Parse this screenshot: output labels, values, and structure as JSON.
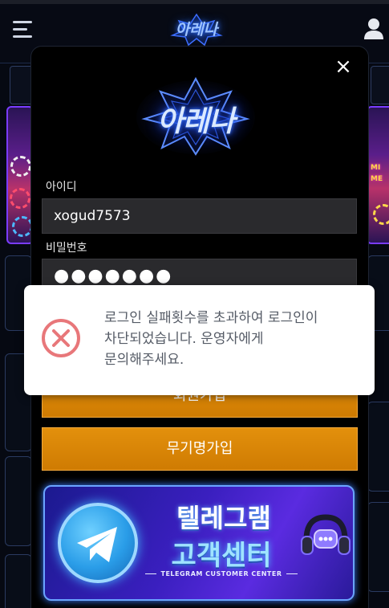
{
  "header": {
    "logo_text": "아레나"
  },
  "login": {
    "logo_text": "아레나",
    "close_glyph": "×",
    "id_label": "아이디",
    "id_value": "xogud7573",
    "password_label": "비밀번호",
    "password_value": "●●●●●●●",
    "signup_button": "회원가입",
    "anon_signup_button": "무기명가입"
  },
  "telegram_banner": {
    "line1": "텔레그램",
    "line2": "고객센터",
    "subtitle": "TELEGRAM CUSTOMER CENTER"
  },
  "alert": {
    "message": "로그인 실패횟수를 초과하여 로그인이 차단되었습니다. 운영자에게 문의해주세요.",
    "icon": "error-x-circle-icon",
    "icon_color": "#e8777a"
  },
  "background_tiles": {
    "left_text": "",
    "right_text_1": "MI",
    "right_text_2": "ME"
  },
  "icons": {
    "menu": "hamburger-menu-icon",
    "user": "user-icon",
    "close": "close-icon",
    "telegram": "telegram-plane-icon",
    "support": "headset-chat-icon"
  },
  "colors": {
    "button_orange": "#d98406",
    "panel_bg": "#000000",
    "field_bg": "#2a2a2d",
    "alert_bg": "#ffffff",
    "banner_blue": "#3a1fbf"
  }
}
